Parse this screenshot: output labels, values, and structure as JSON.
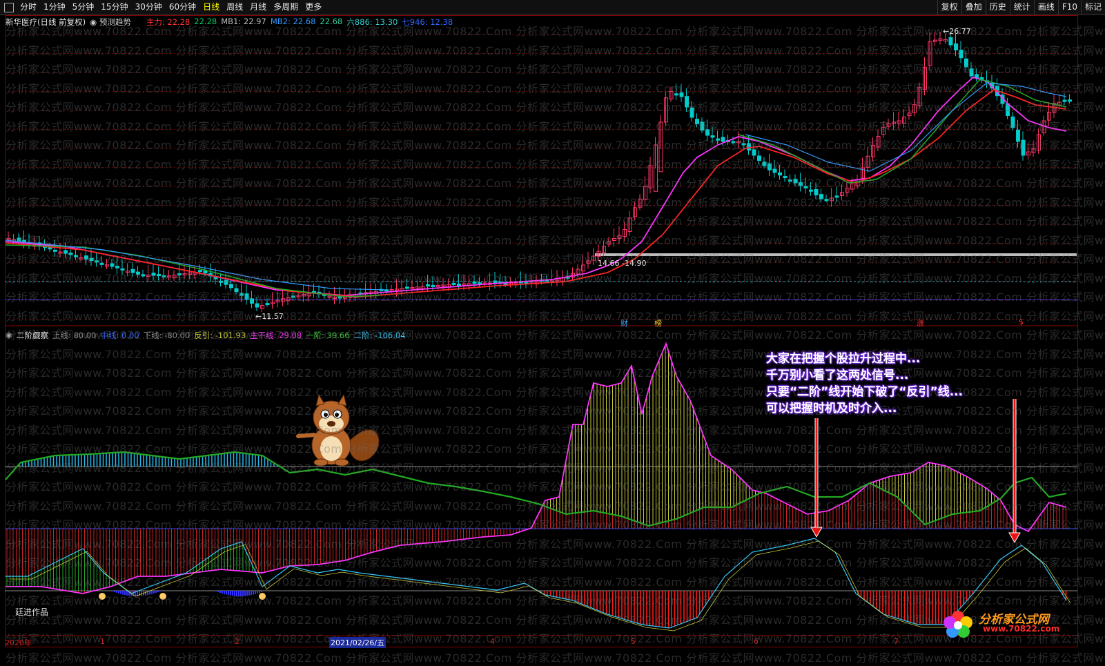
{
  "toolbar": {
    "periods": [
      "分时",
      "1分钟",
      "5分钟",
      "15分钟",
      "30分钟",
      "60分钟",
      "日线",
      "周线",
      "月线",
      "多周期",
      "更多"
    ],
    "active_period": "日线",
    "right_buttons": [
      "复权",
      "叠加",
      "历史",
      "统计",
      "画线",
      "F10",
      "标记"
    ]
  },
  "main_panel": {
    "title": "新华医疗(日线 前复权)",
    "predict": "预测趋势",
    "legend": [
      {
        "label": "主力: 22.28",
        "color": "#ff3333"
      },
      {
        "label": "22.28",
        "color": "#00cc66"
      },
      {
        "label": "MB1: 22.97",
        "color": "#bbbbbb"
      },
      {
        "label": "MB2: 22.68",
        "color": "#3399ff"
      },
      {
        "label": "22.68",
        "color": "#33cc99"
      },
      {
        "label": "六886: 13.30",
        "color": "#33cccc"
      },
      {
        "label": "七946: 12.38",
        "color": "#3366ff"
      }
    ],
    "price_labels": {
      "high": "26.77",
      "low": "11.57",
      "mid1": "14.66",
      "mid2": "14.90"
    },
    "event_marks": [
      {
        "text": "财",
        "color": "#33aaff"
      },
      {
        "text": "榜",
        "color": "#ffcc33"
      },
      {
        "text": "涨",
        "color": "#ff3333"
      },
      {
        "text": "$",
        "color": "#ff3333"
      }
    ]
  },
  "sub_panel": {
    "title": "二阶觑察",
    "legend": [
      {
        "label": "上线: 80.00",
        "color": "#888888"
      },
      {
        "label": "中线: 0.00",
        "color": "#3366ff"
      },
      {
        "label": "下线: -80.00",
        "color": "#888888"
      },
      {
        "label": "反引: -101.93",
        "color": "#cccc33"
      },
      {
        "label": "主干线: 29.08",
        "color": "#ff33ff"
      },
      {
        "label": "一阶: 39.66",
        "color": "#33cc33"
      },
      {
        "label": "二阶: -106.04",
        "color": "#33ccff"
      }
    ],
    "author": "廷进作品"
  },
  "annotation": {
    "lines": [
      "大家在把握个股拉升过程中...",
      "千万别小看了这两处信号...",
      "只要“二阶”线开始下破了“反引”线...",
      "可以把握时机及时介入..."
    ]
  },
  "xaxis": {
    "labels": [
      "2020年",
      "1",
      "2",
      "2021/02/26/五",
      "4",
      "5",
      "6",
      "7"
    ],
    "highlighted": "2021/02/26/五"
  },
  "watermark": {
    "text": "分析家公式网www.70822.Com"
  },
  "logo": {
    "name": "分析家公式网",
    "url": "www.70822.com"
  },
  "colors": {
    "up_candle": "#ff3366",
    "down_candle": "#00cccc",
    "ma_magenta": "#ff33ff",
    "ma_red": "#ff2222",
    "ma_green": "#22aa22",
    "ma_blue": "#3399ff"
  }
}
